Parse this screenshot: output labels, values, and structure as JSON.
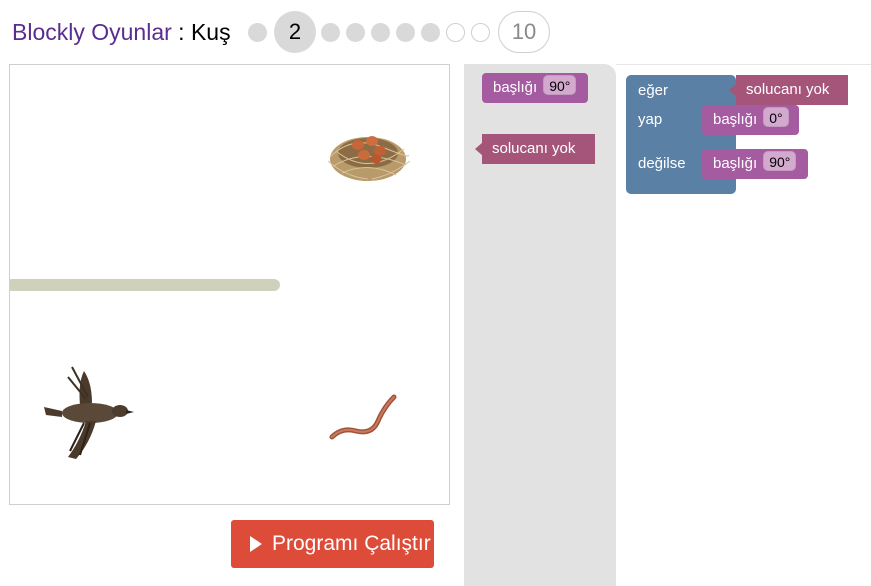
{
  "header": {
    "app_title": "Blockly Oyunlar",
    "separator": " : ",
    "game_name": "Kuş",
    "current_level": "2",
    "last_level": "10"
  },
  "run_button": {
    "label": "Programı Çalıştır",
    "icon": "play-icon"
  },
  "toolbox": {
    "heading_block": {
      "label": "başlığı",
      "value": "90°"
    },
    "condition_block": {
      "label": "solucanı yok"
    }
  },
  "workspace": {
    "if_label": "eğer",
    "condition": "solucanı yok",
    "do_label": "yap",
    "do_heading": {
      "label": "başlığı",
      "value": "0°"
    },
    "else_label": "değilse",
    "else_heading": {
      "label": "başlığı",
      "value": "90°"
    }
  },
  "stage": {
    "items": [
      "nest-icon",
      "bird-icon",
      "worm-icon"
    ]
  },
  "colors": {
    "app_title": "#5b2d8e",
    "run_button": "#dd4b39",
    "heading_block": "#a55b9f",
    "condition_block": "#a5557a",
    "logic_block": "#5b80a5",
    "wall": "#cfd1bc"
  }
}
